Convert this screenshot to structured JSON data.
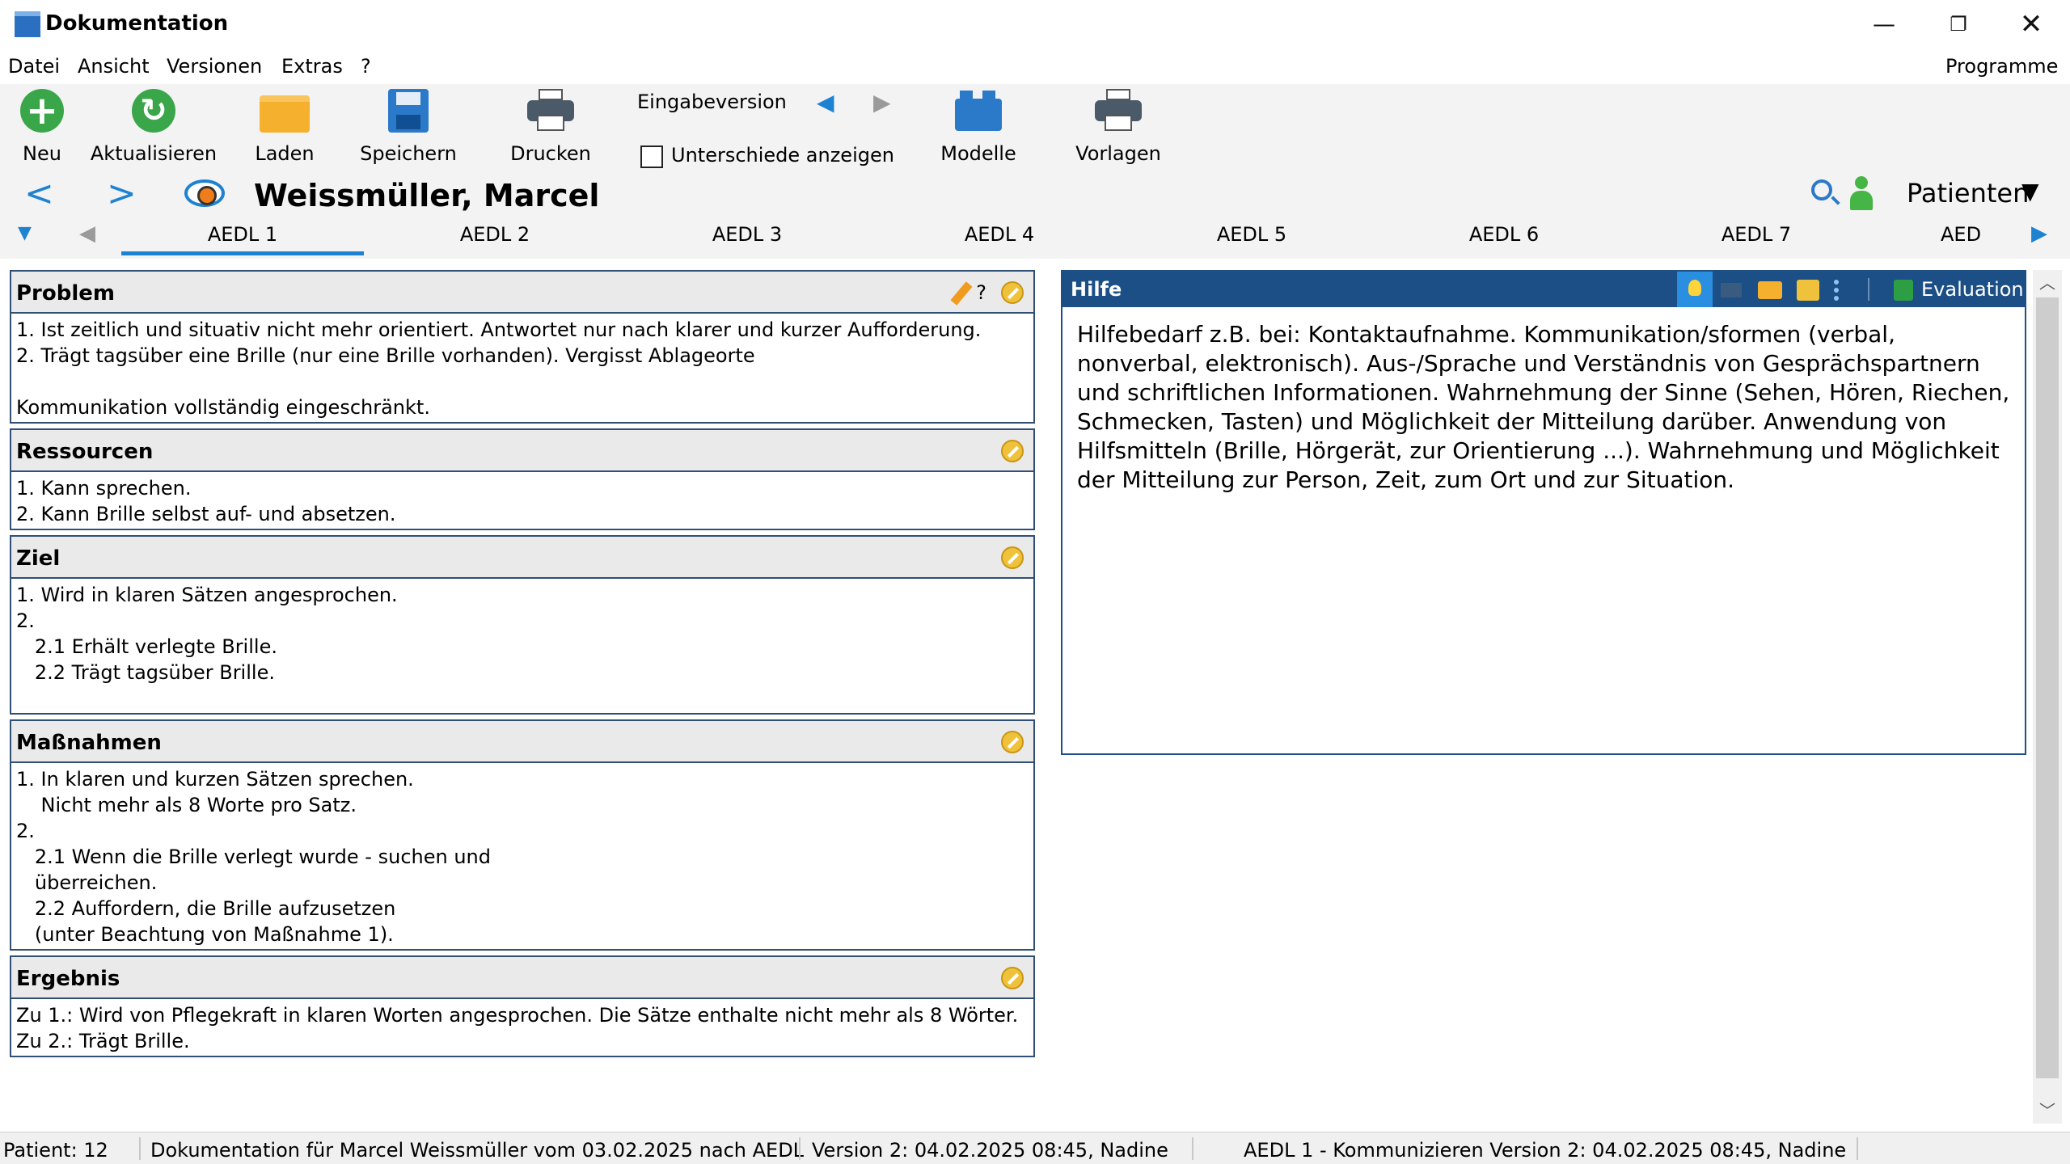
{
  "window": {
    "title": "Dokumentation",
    "minimize_glyph": "—",
    "restore_glyph": "❐",
    "close_glyph": "✕"
  },
  "menu": {
    "items": [
      "Datei",
      "Ansicht",
      "Versionen",
      "Extras",
      "?"
    ],
    "right": "Programme"
  },
  "toolbar": {
    "neu": "Neu",
    "aktualisieren": "Aktualisieren",
    "laden": "Laden",
    "speichern": "Speichern",
    "drucken": "Drucken",
    "eingabeversion": "Eingabeversion",
    "unterschiede": "Unterschiede anzeigen",
    "unterschiede_checked": false,
    "modelle": "Modelle",
    "vorlagen": "Vorlagen",
    "icons": {
      "neu": "plus-circle-icon",
      "aktualisieren": "refresh-icon",
      "laden": "folder-icon",
      "speichern": "save-icon",
      "drucken": "printer-icon",
      "modelle": "lego-block-icon",
      "vorlagen": "printer-icon"
    }
  },
  "patient": {
    "name": "Weissmüller, Marcel",
    "patienten_button": "Patienten"
  },
  "tabs": [
    "AEDL 1",
    "AEDL 2",
    "AEDL 3",
    "AEDL 4",
    "AEDL 5",
    "AEDL 6",
    "AEDL 7",
    "AED"
  ],
  "active_tab": "AEDL 1",
  "sections": {
    "problem": {
      "title": "Problem",
      "qmark": "?",
      "text": "1. Ist zeitlich und situativ nicht mehr orientiert. Antwortet nur nach klarer und kurzer Aufforderung.\n2. Trägt tagsüber eine Brille (nur eine Brille vorhanden). Vergisst Ablageorte\n\nKommunikation vollständig eingeschränkt."
    },
    "ressourcen": {
      "title": "Ressourcen",
      "text": "1. Kann sprechen.\n2. Kann Brille selbst auf- und absetzen."
    },
    "ziel": {
      "title": "Ziel",
      "text": "1. Wird in klaren Sätzen angesprochen.\n2.\n   2.1 Erhält verlegte Brille.\n   2.2 Trägt tagsüber Brille."
    },
    "massnahmen": {
      "title": "Maßnahmen",
      "text": "1. In klaren und kurzen Sätzen sprechen.\n    Nicht mehr als 8 Worte pro Satz.\n2.\n   2.1 Wenn die Brille verlegt wurde - suchen und\n   überreichen.\n   2.2 Auffordern, die Brille aufzusetzen\n   (unter Beachtung von Maßnahme 1)."
    },
    "ergebnis": {
      "title": "Ergebnis",
      "text": "Zu 1.: Wird von Pflegekraft in klaren Worten angesprochen. Die Sätze enthalte nicht mehr als 8 Wörter.\nZu 2.: Trägt Brille."
    }
  },
  "hilfe": {
    "title": "Hilfe",
    "evaluation": "Evaluation",
    "text": "Hilfebedarf z.B. bei: Kontaktaufnahme. Kommunikation/sformen (verbal, nonverbal, elektronisch). Aus-/Sprache und Verständnis von Gesprächspartnern und schriftlichen Informationen. Wahrnehmung der Sinne (Sehen, Hören, Riechen, Schmecken, Tasten) und Möglichkeit der Mitteilung darüber. Anwendung von Hilfsmitteln (Brille, Hörgerät, zur Orientierung ...). Wahrnehmung und Möglichkeit der Mitteilung zur Person, Zeit, zum Ort und zur Situation."
  },
  "statusbar": {
    "patient": "Patient: 12",
    "doc": "Dokumentation für Marcel Weissmüller vom 03.02.2025 nach AEDL",
    "version": "Version 2: 04.02.2025 08:45, Nadine",
    "aedl": "AEDL 1 - Kommunizieren Version 2: 04.02.2025 08:45, Nadine"
  },
  "colors": {
    "accent": "#1e82d2",
    "header_blue": "#1b4f85",
    "section_border": "#2f4f75",
    "green": "#3aa64a"
  }
}
